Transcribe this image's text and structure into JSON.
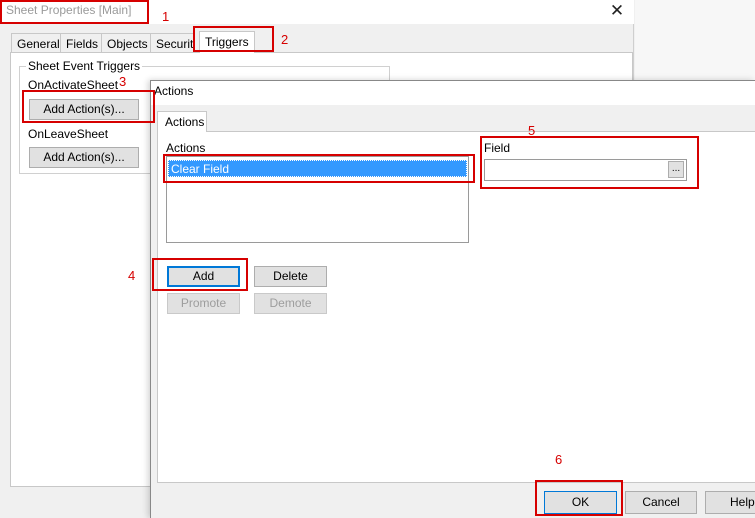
{
  "sheet_properties": {
    "title": "Sheet Properties [Main]",
    "close_glyph": "✕",
    "tabs": [
      "General",
      "Fields",
      "Objects",
      "Security",
      "Triggers"
    ],
    "active_tab": "Triggers",
    "group_title": "Sheet Event Triggers",
    "on_activate_label": "OnActivateSheet",
    "on_activate_button": "Add Action(s)...",
    "on_leave_label": "OnLeaveSheet",
    "on_leave_button": "Add Action(s)..."
  },
  "actions_dialog": {
    "title": "Actions",
    "tab": "Actions",
    "list_label": "Actions",
    "list_items": [
      "Clear Field"
    ],
    "field_label": "Field",
    "field_value": "",
    "browse_label": "...",
    "buttons": {
      "add": "Add",
      "delete": "Delete",
      "promote": "Promote",
      "demote": "Demote",
      "ok": "OK",
      "cancel": "Cancel",
      "help": "Help"
    }
  },
  "annotations": {
    "marker_1": "1",
    "marker_2": "2",
    "marker_3": "3",
    "marker_4": "4",
    "marker_5": "5",
    "marker_6": "6",
    "color": "#d60000"
  }
}
